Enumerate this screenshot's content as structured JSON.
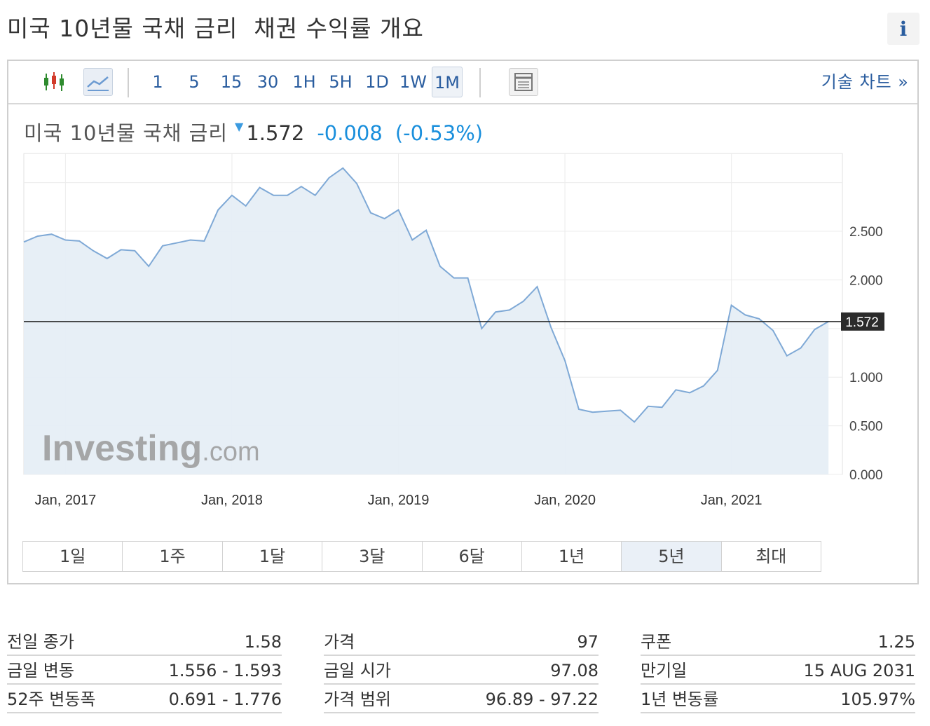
{
  "page": {
    "title": "미국 10년물 국채 금리  채권 수익률 개요",
    "info_icon": "i"
  },
  "toolbar": {
    "intervals": [
      "1",
      "5",
      "15",
      "30",
      "1H",
      "5H",
      "1D",
      "1W",
      "1M"
    ],
    "active_interval": "1M",
    "technical_chart_label": "기술 차트 »"
  },
  "instrument": {
    "name": "미국 10년물 국채 금리",
    "price": "1.572",
    "change": "-0.008",
    "change_pct": "(-0.53%)",
    "direction_icon": "down-triangle-icon",
    "down_color": "#1a8fdc"
  },
  "chart_data": {
    "type": "area",
    "x": [
      "2016-10",
      "2016-11",
      "2016-12",
      "2017-01",
      "2017-02",
      "2017-03",
      "2017-04",
      "2017-05",
      "2017-06",
      "2017-07",
      "2017-08",
      "2017-09",
      "2017-10",
      "2017-11",
      "2017-12",
      "2018-01",
      "2018-02",
      "2018-03",
      "2018-04",
      "2018-05",
      "2018-06",
      "2018-07",
      "2018-08",
      "2018-09",
      "2018-10",
      "2018-11",
      "2018-12",
      "2019-01",
      "2019-02",
      "2019-03",
      "2019-04",
      "2019-05",
      "2019-06",
      "2019-07",
      "2019-08",
      "2019-09",
      "2019-10",
      "2019-11",
      "2019-12",
      "2020-01",
      "2020-02",
      "2020-03",
      "2020-04",
      "2020-05",
      "2020-06",
      "2020-07",
      "2020-08",
      "2020-09",
      "2020-10",
      "2020-11",
      "2020-12",
      "2021-01",
      "2021-02",
      "2021-03",
      "2021-04",
      "2021-05",
      "2021-06",
      "2021-07",
      "2021-08",
      "2021-09"
    ],
    "series": [
      {
        "values": [
          2.39,
          2.45,
          2.47,
          2.41,
          2.4,
          2.3,
          2.22,
          2.31,
          2.3,
          2.14,
          2.35,
          2.38,
          2.41,
          2.4,
          2.72,
          2.87,
          2.76,
          2.95,
          2.87,
          2.87,
          2.96,
          2.87,
          3.05,
          3.15,
          2.99,
          2.69,
          2.63,
          2.72,
          2.41,
          2.51,
          2.14,
          2.02,
          2.02,
          1.5,
          1.67,
          1.69,
          1.78,
          1.93,
          1.51,
          1.17,
          0.67,
          0.64,
          0.65,
          0.66,
          0.54,
          0.7,
          0.69,
          0.87,
          0.84,
          0.91,
          1.07,
          1.74,
          1.64,
          1.6,
          1.48,
          1.22,
          1.3,
          1.49,
          1.572
        ]
      }
    ],
    "x_tick_labels": [
      "Jan, 2017",
      "Jan, 2018",
      "Jan, 2019",
      "Jan, 2020",
      "Jan, 2021"
    ],
    "y_tick_labels": [
      "2.500",
      "2.000",
      "1.000",
      "0.500",
      "0.000"
    ],
    "ylim": [
      0,
      3.3
    ],
    "current_value_label": "1.572",
    "line_color": "#7fa9d6",
    "fill_color": "#e6eef6",
    "watermark": "Investing.com",
    "grid": true
  },
  "ranges": {
    "buttons": [
      "1일",
      "1주",
      "1달",
      "3달",
      "6달",
      "1년",
      "5년",
      "최대"
    ],
    "active": "5년"
  },
  "stats": {
    "col1": [
      {
        "label": "전일 종가",
        "value": "1.58"
      },
      {
        "label": "금일 변동",
        "value": "1.556 - 1.593"
      },
      {
        "label": "52주 변동폭",
        "value": "0.691 - 1.776"
      }
    ],
    "col2": [
      {
        "label": "가격",
        "value": "97"
      },
      {
        "label": "금일 시가",
        "value": "97.08"
      },
      {
        "label": "가격 범위",
        "value": "96.89 - 97.22"
      }
    ],
    "col3": [
      {
        "label": "쿠폰",
        "value": "1.25"
      },
      {
        "label": "만기일",
        "value": "15 AUG 2031"
      },
      {
        "label": "1년 변동률",
        "value": "105.97%"
      }
    ]
  }
}
